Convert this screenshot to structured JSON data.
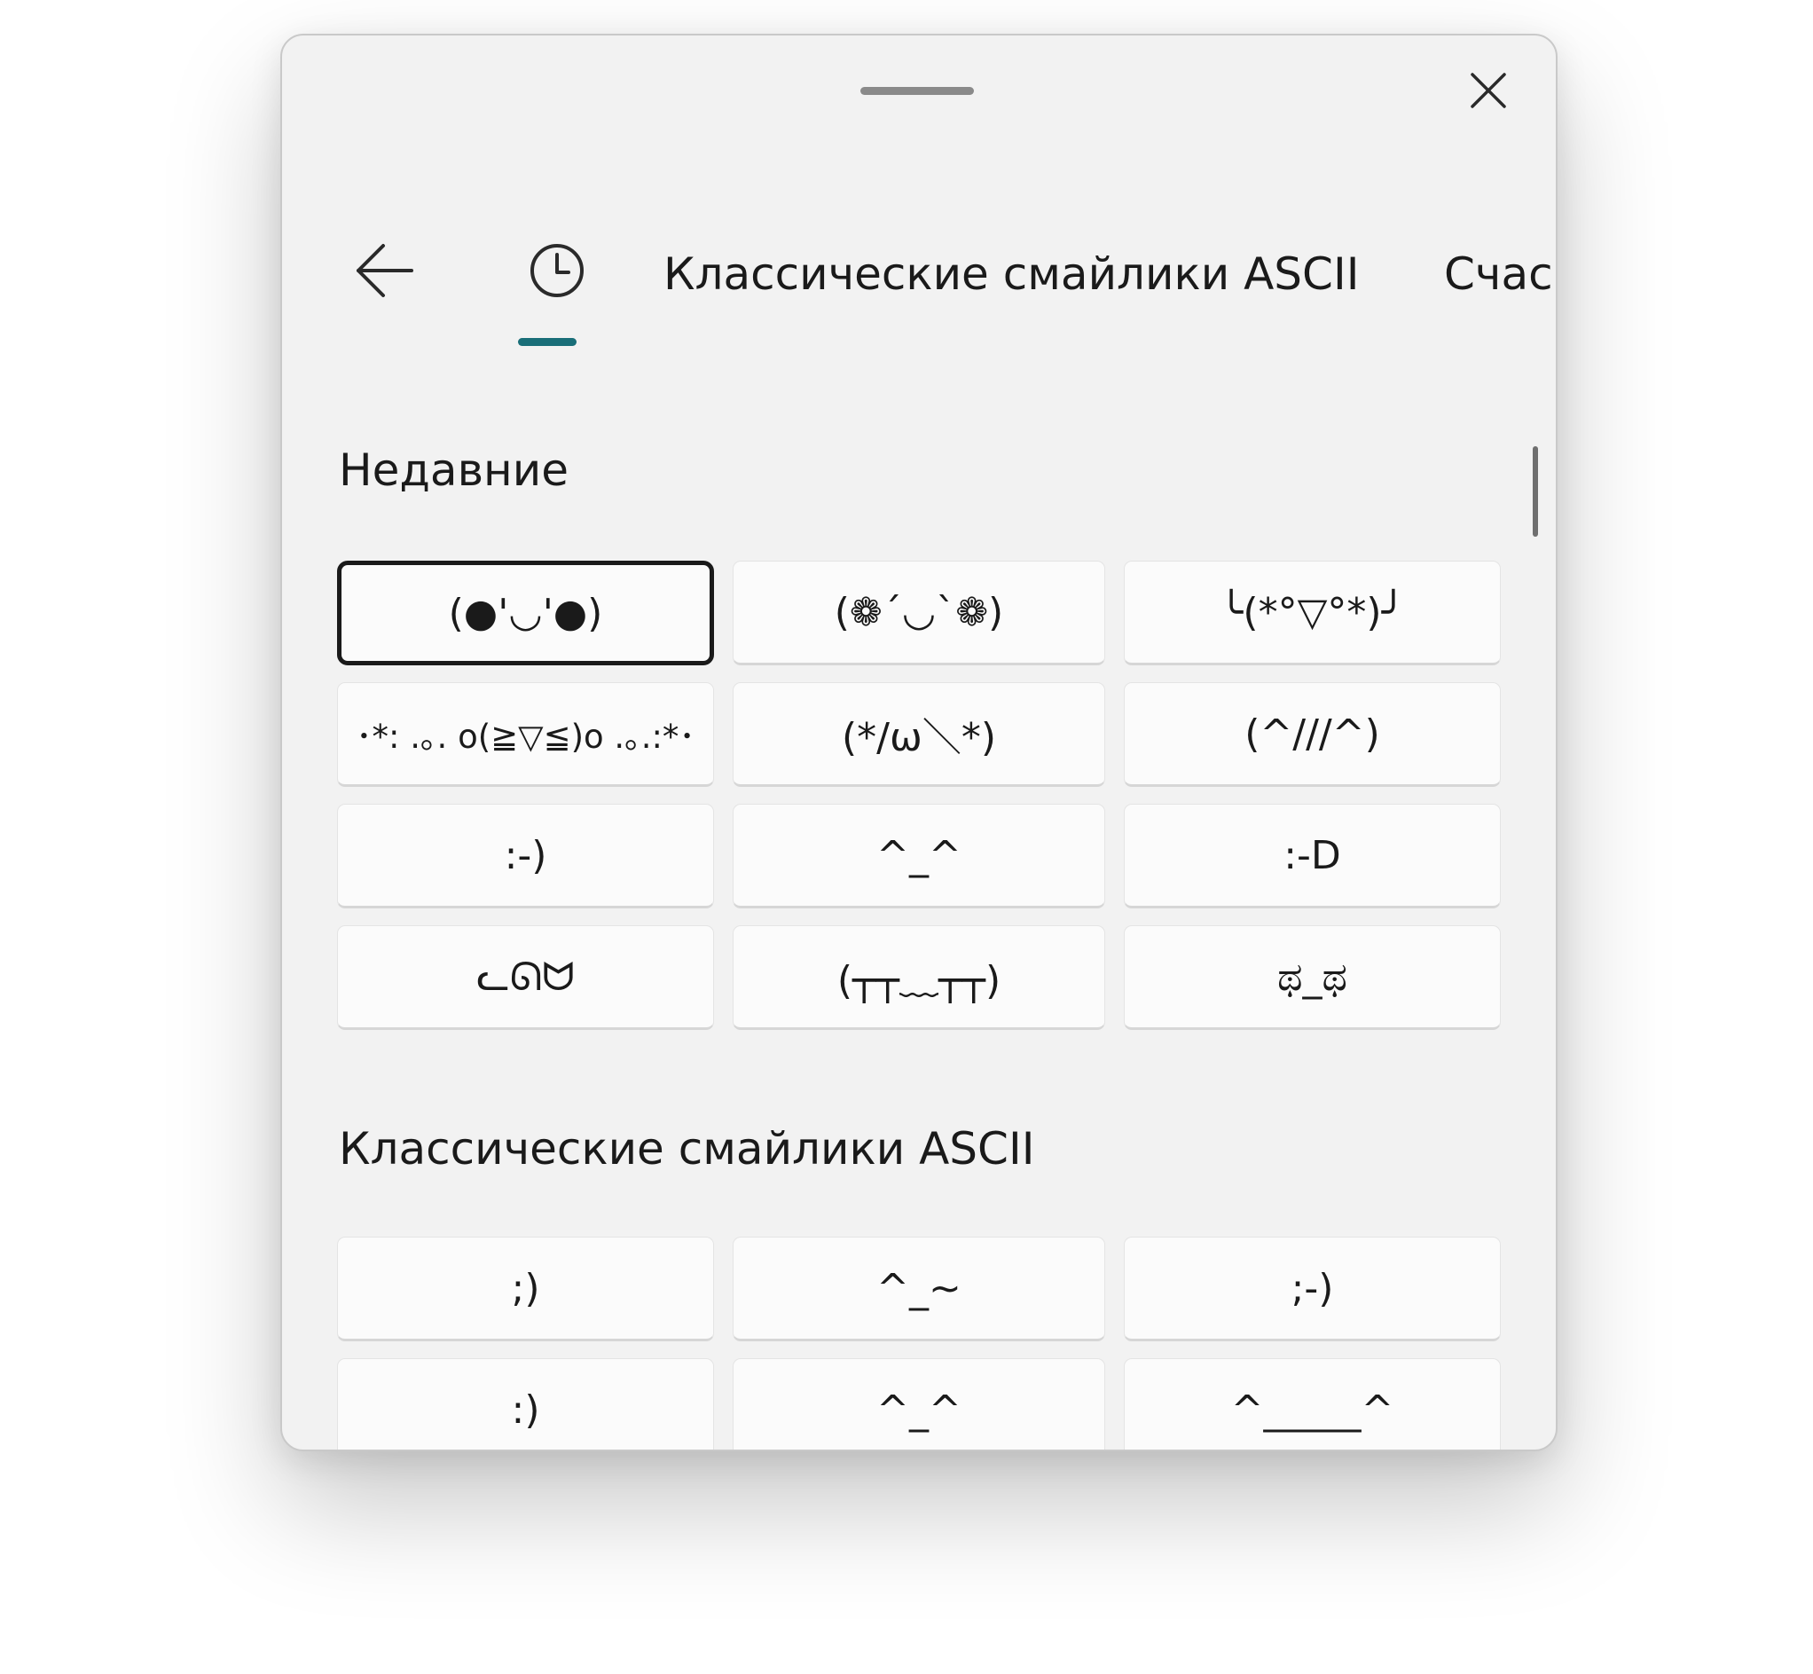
{
  "header": {
    "tabs": [
      {
        "label": "Классические смайлики ASCII"
      },
      {
        "label": "Счас"
      }
    ]
  },
  "sections": {
    "recent": {
      "title": "Недавние",
      "items": [
        "(●'◡'●)",
        "(❁´◡`❁)",
        "╰(*°▽°*)╯",
        "･*: .｡. o(≧▽≦)o .｡.:*･",
        "(*/ω＼*)",
        "(^///^)",
        ":-)",
        "^_^",
        ":-D",
        "ᓚᘏᗢ",
        "(┬┬﹏┬┬)",
        "ಥ_ಥ"
      ]
    },
    "classic": {
      "title": "Классические смайлики ASCII",
      "items": [
        ";)",
        "^_~",
        ";-)",
        ":)",
        "^_^",
        "^_____^"
      ]
    }
  },
  "colors": {
    "accent": "#196e78",
    "panel_bg": "#f2f2f2",
    "cell_bg": "#fbfbfb"
  },
  "icons": {
    "back": "arrow-left-icon",
    "recent": "clock-icon",
    "close": "close-icon"
  }
}
